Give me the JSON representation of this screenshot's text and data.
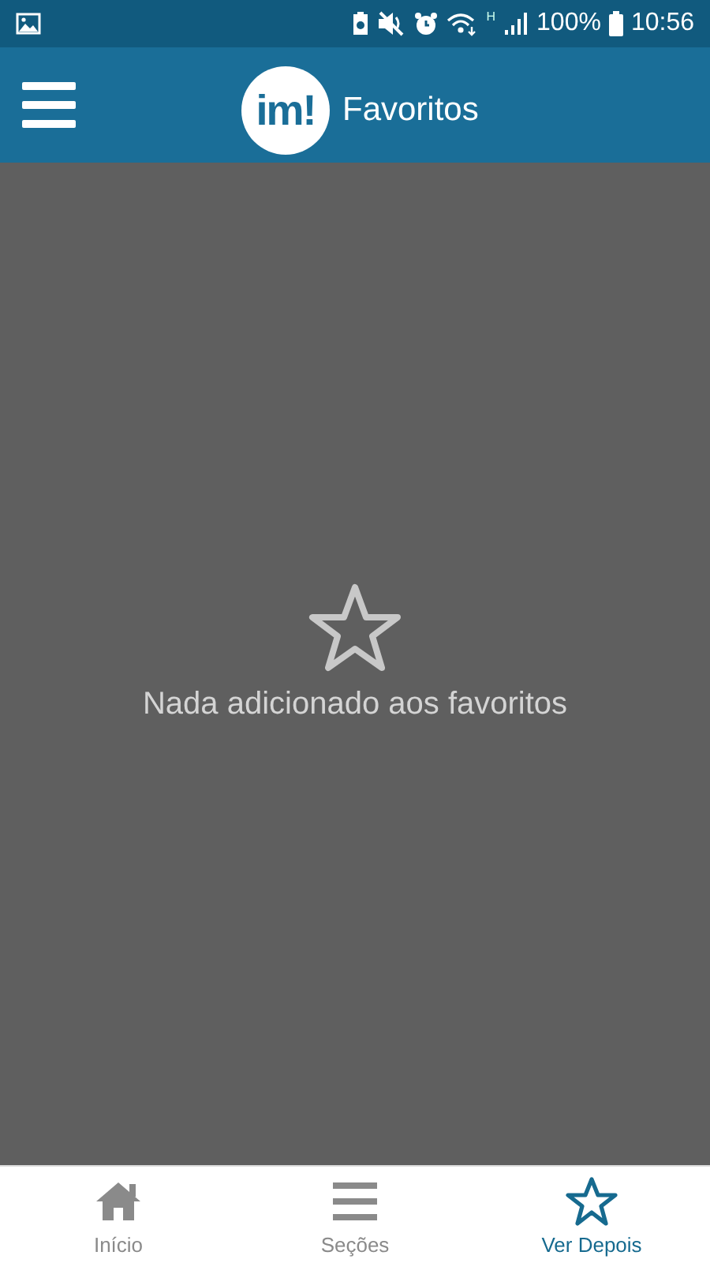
{
  "status_bar": {
    "network_type": "H",
    "battery": "100%",
    "time": "10:56"
  },
  "app_bar": {
    "logo": "im!",
    "title": "Favoritos"
  },
  "empty_state": {
    "message": "Nada adicionado aos favoritos"
  },
  "bottom_nav": [
    {
      "kind": "home",
      "label": "Início",
      "selected": false
    },
    {
      "kind": "list",
      "label": "Seções",
      "selected": false
    },
    {
      "kind": "star",
      "label": "Ver Depois",
      "selected": true
    }
  ]
}
